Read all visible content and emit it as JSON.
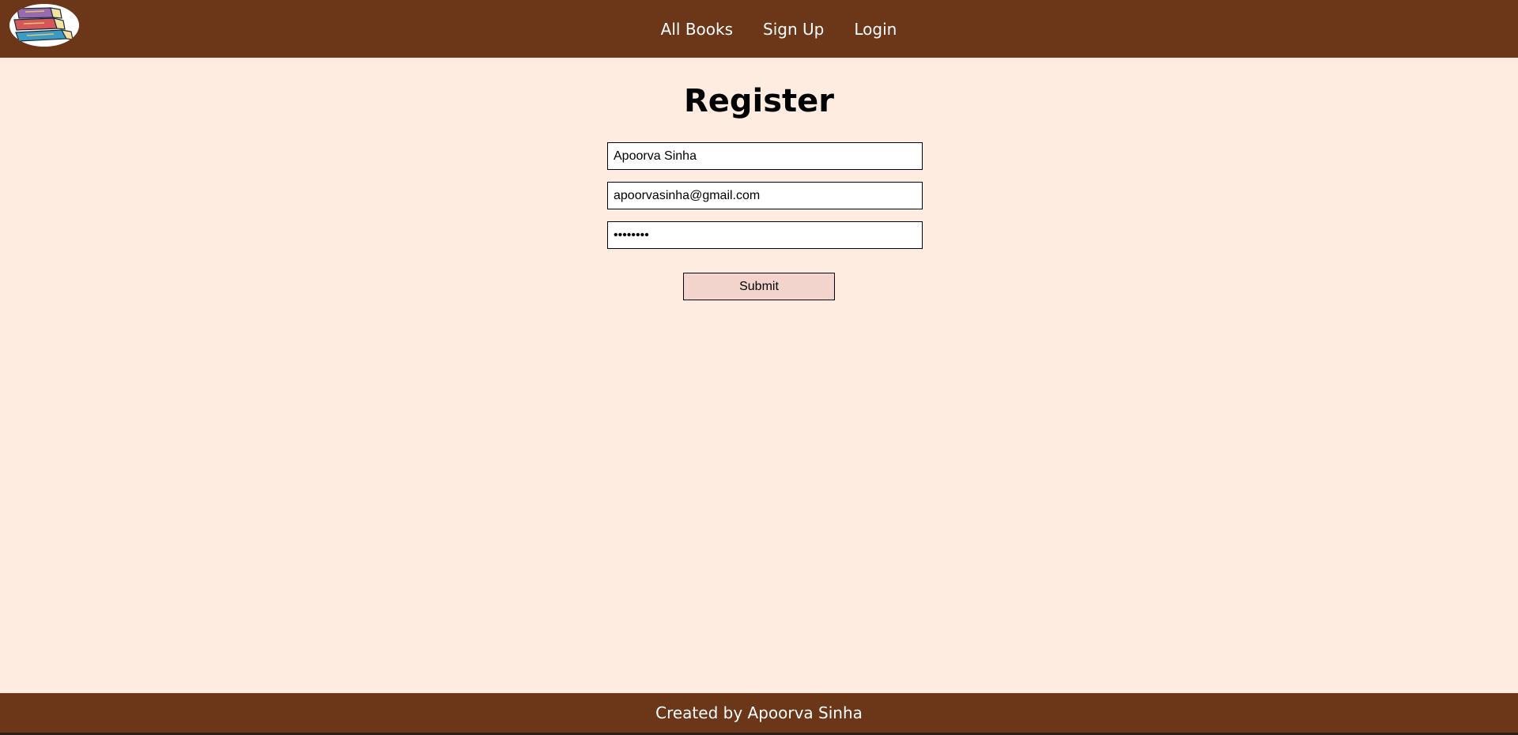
{
  "header": {
    "logo_icon": "stacked-books-logo-icon",
    "nav": [
      {
        "label": "All Books"
      },
      {
        "label": "Sign Up"
      },
      {
        "label": "Login"
      }
    ]
  },
  "main": {
    "title": "Register",
    "form": {
      "name_value": "Apoorva Sinha",
      "email_value": "apoorvasinha@gmail.com",
      "password_value": "password",
      "submit_label": "Submit"
    }
  },
  "footer": {
    "text": "Created by Apoorva Sinha"
  },
  "colors": {
    "header_bg": "#6b3718",
    "page_bg": "#ffece0",
    "button_bg": "#f2d4cc"
  }
}
